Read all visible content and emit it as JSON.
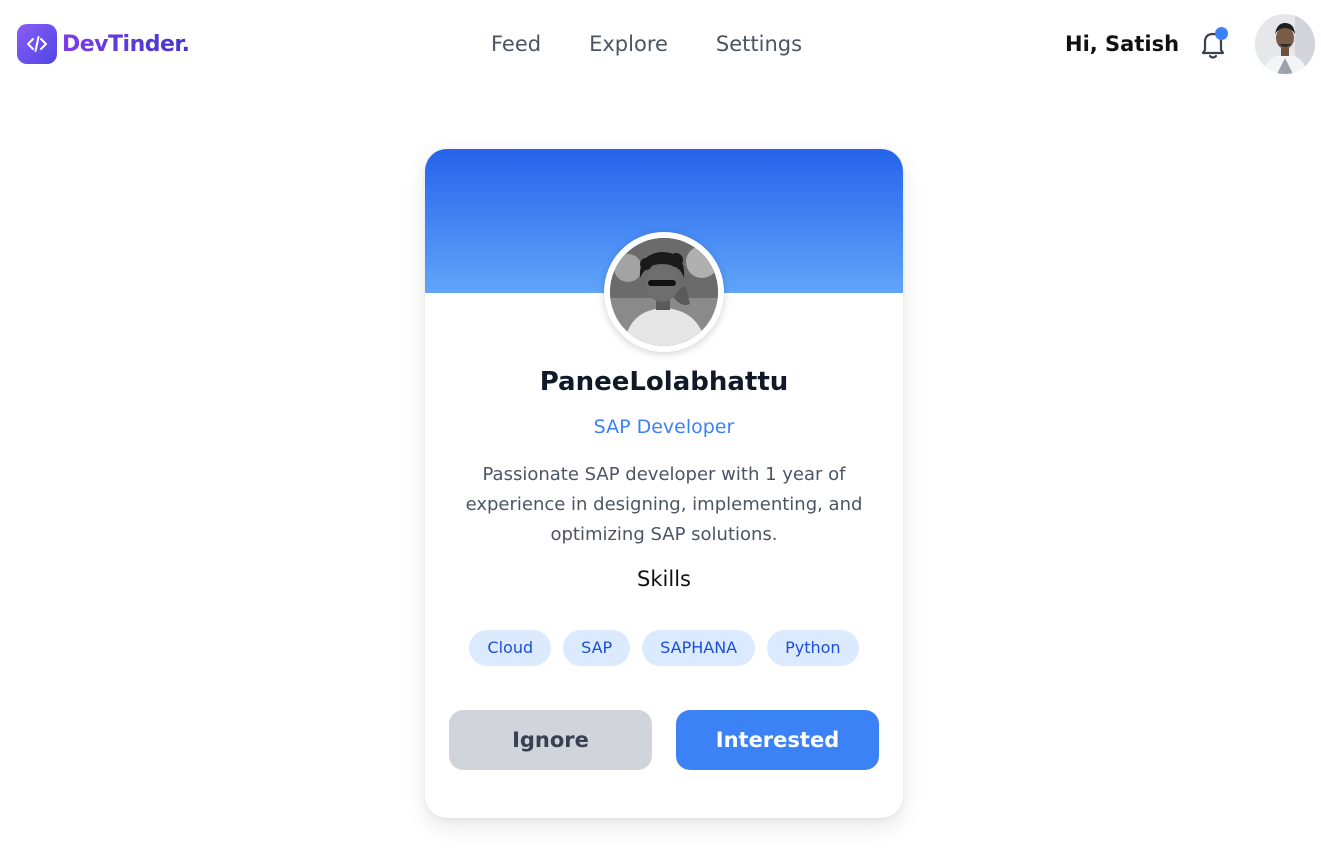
{
  "brand": {
    "name": "DevTinder.",
    "logo_icon": "code-icon"
  },
  "nav": {
    "items": [
      {
        "label": "Feed"
      },
      {
        "label": "Explore"
      },
      {
        "label": "Settings"
      }
    ]
  },
  "user": {
    "greeting": "Hi, Satish",
    "avatar_icon": "user-avatar-photo"
  },
  "notifications": {
    "icon": "bell-icon",
    "has_unread": true
  },
  "card": {
    "name": "PaneeLolabhattu",
    "role": "SAP Developer",
    "bio": "Passionate SAP developer with 1 year of experience in designing, implementing, and optimizing SAP solutions.",
    "skills_heading": "Skills",
    "skills": [
      {
        "label": "Cloud"
      },
      {
        "label": "SAP"
      },
      {
        "label": "SAPHANA"
      },
      {
        "label": "Python"
      }
    ],
    "actions": {
      "ignore_label": "Ignore",
      "interested_label": "Interested"
    }
  },
  "colors": {
    "accent": "#3b82f6",
    "brand_gradient_start": "#8b5cf6",
    "brand_gradient_end": "#4338ca",
    "banner_top": "#2563eb",
    "banner_bottom": "#60a5fa",
    "skill_bg": "#dbeafe",
    "ignore_bg": "#d1d5db"
  }
}
